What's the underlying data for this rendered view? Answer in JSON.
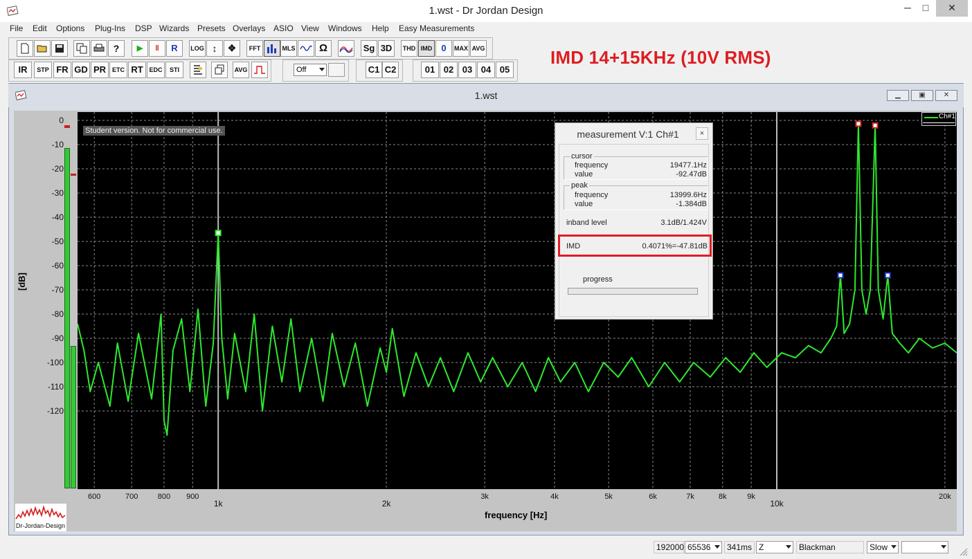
{
  "window": {
    "title": "1.wst - Dr Jordan Design",
    "minimize": "─",
    "maximize": "□",
    "close": "✕"
  },
  "menu": [
    "File",
    "Edit",
    "Options",
    "Plug-Ins",
    "DSP",
    "Wizards",
    "Presets",
    "Overlays",
    "ASIO",
    "View",
    "Windows",
    "Help",
    "Easy Measurements"
  ],
  "toolbar": {
    "row1": {
      "file_icons": [
        "new-icon",
        "open-icon",
        "save-icon",
        "copy-icon",
        "print-icon",
        "help-icon"
      ],
      "play": "▶",
      "pause": "‖",
      "record": "R",
      "log": "LOG",
      "fft": "FFT",
      "mls": "MLS",
      "sg": "Sg",
      "3d": "3D",
      "thd": "THD",
      "imd": "IMD",
      "zero": "0",
      "max": "MAX",
      "avg": "AVG"
    },
    "row2": {
      "ir": "IR",
      "stp": "STP",
      "fr": "FR",
      "gd": "GD",
      "pr": "PR",
      "etc": "ETC",
      "rt": "RT",
      "edc": "EDC",
      "sti": "STI",
      "avg": "AVG",
      "select_value": "Off",
      "c1": "C1",
      "c2": "C2",
      "presets": [
        "01",
        "02",
        "03",
        "04",
        "05"
      ]
    }
  },
  "annotation": "IMD 14+15KHz (10V RMS)",
  "child": {
    "title": "1.wst",
    "notice": "Student version. Not for commercial use.",
    "legend": "Ch#1",
    "logo_text": "Dr-Jordan-Design"
  },
  "chart_data": {
    "type": "line",
    "x_scale": "log",
    "xlim": [
      560,
      21000
    ],
    "ylim": [
      -135,
      0
    ],
    "xlabel": "frequency [Hz]",
    "ylabel": "[dB]",
    "y_ticks": [
      "0",
      "-10",
      "-20",
      "-30",
      "-40",
      "-50",
      "-60",
      "-70",
      "-80",
      "-90",
      "-100",
      "-110",
      "-120"
    ],
    "x_ticks_minor": [
      {
        "v": 600,
        "label": "600"
      },
      {
        "v": 700,
        "label": "700"
      },
      {
        "v": 800,
        "label": "800"
      },
      {
        "v": 900,
        "label": "900"
      },
      {
        "v": 3000,
        "label": "3k"
      },
      {
        "v": 4000,
        "label": "4k"
      },
      {
        "v": 5000,
        "label": "5k"
      },
      {
        "v": 6000,
        "label": "6k"
      },
      {
        "v": 7000,
        "label": "7k"
      },
      {
        "v": 8000,
        "label": "8k"
      },
      {
        "v": 9000,
        "label": "9k"
      },
      {
        "v": 20000,
        "label": "20k"
      }
    ],
    "x_ticks_major": [
      {
        "v": 1000,
        "label": "1k"
      },
      {
        "v": 2000,
        "label": "2k"
      },
      {
        "v": 10000,
        "label": "10k"
      }
    ],
    "grid": true,
    "series": [
      {
        "name": "Ch#1",
        "color": "#2ee82e",
        "points": [
          [
            560,
            -84
          ],
          [
            575,
            -95
          ],
          [
            590,
            -112
          ],
          [
            610,
            -100
          ],
          [
            640,
            -118
          ],
          [
            660,
            -92
          ],
          [
            690,
            -116
          ],
          [
            720,
            -88
          ],
          [
            760,
            -115
          ],
          [
            790,
            -80
          ],
          [
            800,
            -124
          ],
          [
            810,
            -130
          ],
          [
            830,
            -95
          ],
          [
            860,
            -82
          ],
          [
            890,
            -112
          ],
          [
            920,
            -78
          ],
          [
            950,
            -118
          ],
          [
            980,
            -92
          ],
          [
            1000,
            -46.5
          ],
          [
            1015,
            -90
          ],
          [
            1040,
            -115
          ],
          [
            1070,
            -88
          ],
          [
            1120,
            -112
          ],
          [
            1160,
            -80
          ],
          [
            1200,
            -120
          ],
          [
            1250,
            -85
          ],
          [
            1300,
            -108
          ],
          [
            1350,
            -82
          ],
          [
            1400,
            -112
          ],
          [
            1470,
            -90
          ],
          [
            1540,
            -116
          ],
          [
            1600,
            -88
          ],
          [
            1680,
            -110
          ],
          [
            1760,
            -92
          ],
          [
            1850,
            -118
          ],
          [
            1950,
            -94
          ],
          [
            2000,
            -104
          ],
          [
            2050,
            -86
          ],
          [
            2150,
            -114
          ],
          [
            2260,
            -96
          ],
          [
            2380,
            -110
          ],
          [
            2500,
            -98
          ],
          [
            2640,
            -112
          ],
          [
            2800,
            -96
          ],
          [
            2950,
            -108
          ],
          [
            3100,
            -98
          ],
          [
            3300,
            -110
          ],
          [
            3500,
            -100
          ],
          [
            3700,
            -112
          ],
          [
            3900,
            -98
          ],
          [
            4100,
            -108
          ],
          [
            4350,
            -100
          ],
          [
            4600,
            -112
          ],
          [
            4900,
            -100
          ],
          [
            5200,
            -106
          ],
          [
            5500,
            -98
          ],
          [
            5900,
            -110
          ],
          [
            6300,
            -100
          ],
          [
            6700,
            -108
          ],
          [
            7100,
            -100
          ],
          [
            7600,
            -106
          ],
          [
            8100,
            -98
          ],
          [
            8600,
            -104
          ],
          [
            9100,
            -96
          ],
          [
            9600,
            -102
          ],
          [
            10200,
            -96
          ],
          [
            10800,
            -98
          ],
          [
            11400,
            -93
          ],
          [
            12000,
            -96
          ],
          [
            12500,
            -90
          ],
          [
            12800,
            -85
          ],
          [
            13000,
            -64
          ],
          [
            13200,
            -88
          ],
          [
            13500,
            -84
          ],
          [
            13800,
            -70
          ],
          [
            14000,
            -1.4
          ],
          [
            14200,
            -70
          ],
          [
            14450,
            -80
          ],
          [
            14700,
            -70
          ],
          [
            15000,
            -2.1
          ],
          [
            15200,
            -70
          ],
          [
            15500,
            -82
          ],
          [
            15800,
            -64
          ],
          [
            16100,
            -88
          ],
          [
            16600,
            -92
          ],
          [
            17200,
            -96
          ],
          [
            18000,
            -90
          ],
          [
            19000,
            -94
          ],
          [
            20000,
            -92
          ],
          [
            21000,
            -96
          ]
        ]
      }
    ],
    "markers": [
      {
        "x": 1000,
        "y": -46.5,
        "color": "#2ee82e"
      },
      {
        "x": 14000,
        "y": -1.4,
        "color": "#d12020"
      },
      {
        "x": 15000,
        "y": -2.1,
        "color": "#d12020"
      },
      {
        "x": 13000,
        "y": -64,
        "color": "#2233cc"
      },
      {
        "x": 15800,
        "y": -64,
        "color": "#2233cc"
      }
    ],
    "cursor_lines": [
      1000,
      10000
    ]
  },
  "measurement": {
    "title": "measurement V:1 Ch#1",
    "close": "×",
    "cursor": {
      "group": "cursor",
      "frequency_label": "frequency",
      "frequency": "19477.1Hz",
      "value_label": "value",
      "value": "-92.47dB"
    },
    "peak": {
      "group": "peak",
      "frequency_label": "frequency",
      "frequency": "13999.6Hz",
      "value_label": "value",
      "value": "-1.384dB"
    },
    "inband_label": "inband level",
    "inband_value": "3.1dB/1.424V",
    "imd_label": "IMD",
    "imd_value": "0.4071%=-47.81dB",
    "progress_label": "progress",
    "progress_fraction": 0.0,
    "highlight_color": "#e01b24"
  },
  "statusbar": {
    "rate": "192000",
    "fft_size": "65536",
    "duration": "341ms",
    "mode": "Z",
    "window": "Blackman",
    "speed": "Slow",
    "extra": ""
  }
}
